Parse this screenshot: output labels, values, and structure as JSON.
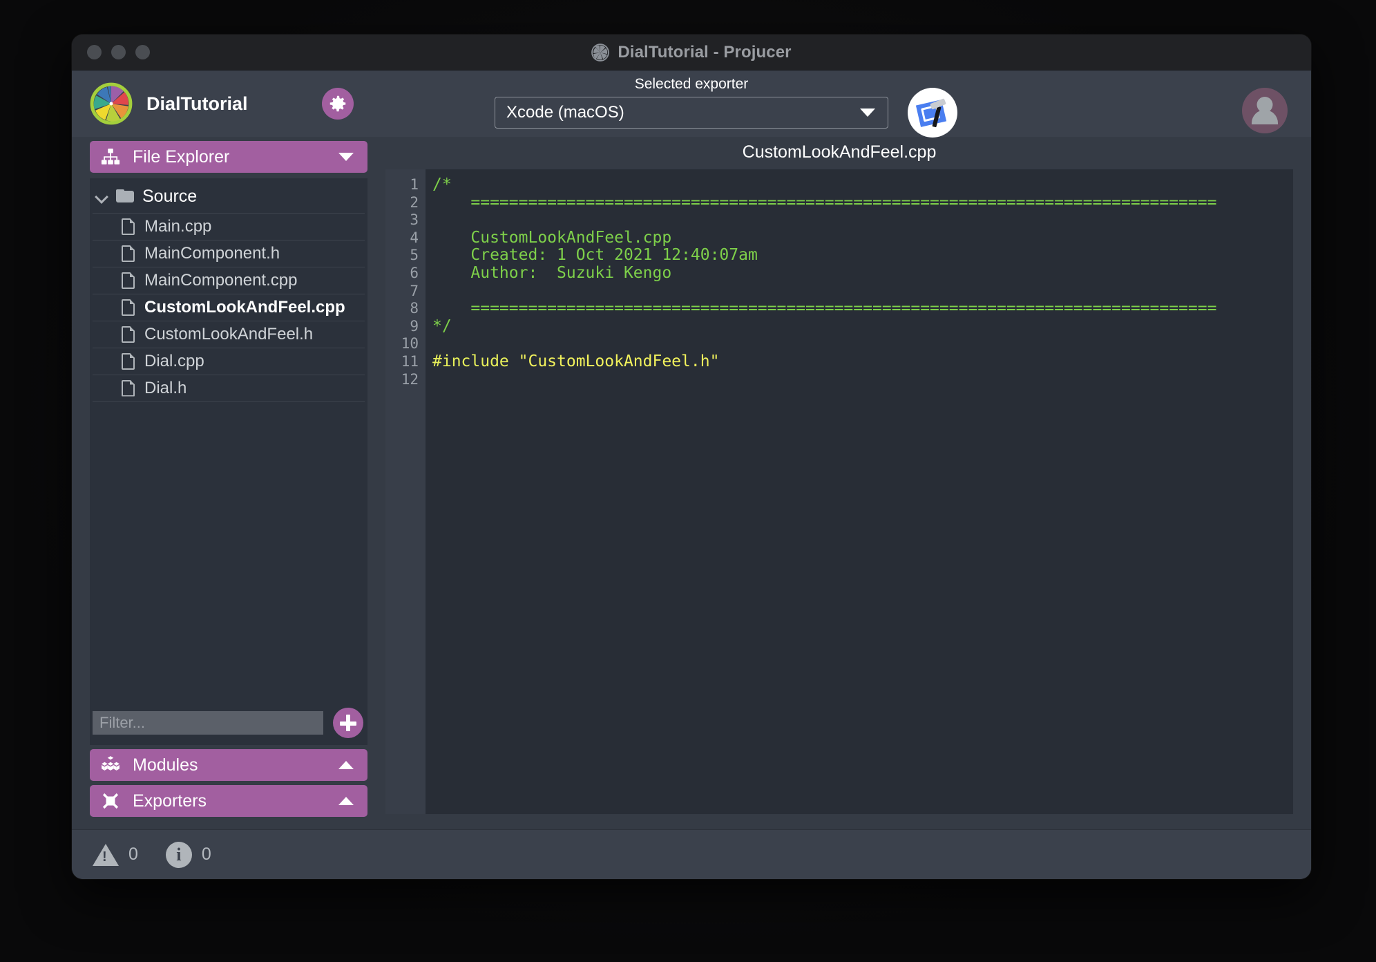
{
  "window": {
    "title": "DialTutorial - Projucer",
    "traffic_lights": [
      "close",
      "minimize",
      "maximize"
    ]
  },
  "toolbar": {
    "project_name": "DialTutorial",
    "settings_icon": "gear-icon",
    "exporter_label": "Selected exporter",
    "exporter_value": "Xcode (macOS)",
    "exporter_options": [
      "Xcode (macOS)"
    ],
    "launch_icon": "xcode-icon",
    "avatar_icon": "user-avatar-icon"
  },
  "sidebar": {
    "file_explorer": {
      "label": "File Explorer",
      "icon": "hierarchy-icon",
      "expanded": true,
      "arrow": "chevron-down-icon"
    },
    "group": {
      "label": "Source",
      "icon": "folder-icon",
      "chevron": "chevron-down-icon"
    },
    "files": [
      {
        "label": "Main.cpp",
        "selected": false
      },
      {
        "label": "MainComponent.h",
        "selected": false
      },
      {
        "label": "MainComponent.cpp",
        "selected": false
      },
      {
        "label": "CustomLookAndFeel.cpp",
        "selected": true
      },
      {
        "label": "CustomLookAndFeel.h",
        "selected": false
      },
      {
        "label": "Dial.cpp",
        "selected": false
      },
      {
        "label": "Dial.h",
        "selected": false
      }
    ],
    "filter_placeholder": "Filter...",
    "filter_value": "",
    "add_button_icon": "plus-icon",
    "modules": {
      "label": "Modules",
      "icon": "modules-cubes-icon",
      "arrow": "chevron-up-icon"
    },
    "exporters": {
      "label": "Exporters",
      "icon": "plug-icon",
      "arrow": "chevron-up-icon"
    }
  },
  "editor": {
    "filename": "CustomLookAndFeel.cpp",
    "line_numbers": [
      "1",
      "2",
      "3",
      "4",
      "5",
      "6",
      "7",
      "8",
      "9",
      "10",
      "11",
      "12"
    ],
    "lines": [
      {
        "n": 1,
        "segments": [
          {
            "text": "/*",
            "cls": "c-comment"
          }
        ]
      },
      {
        "n": 2,
        "segments": [
          {
            "text": "    ==============================================================================",
            "cls": "c-comment"
          }
        ]
      },
      {
        "n": 3,
        "segments": [
          {
            "text": "",
            "cls": "c-comment"
          }
        ]
      },
      {
        "n": 4,
        "segments": [
          {
            "text": "    CustomLookAndFeel.cpp",
            "cls": "c-comment"
          }
        ]
      },
      {
        "n": 5,
        "segments": [
          {
            "text": "    Created: 1 Oct 2021 12:40:07am",
            "cls": "c-comment"
          }
        ]
      },
      {
        "n": 6,
        "segments": [
          {
            "text": "    Author:  Suzuki Kengo",
            "cls": "c-comment"
          }
        ]
      },
      {
        "n": 7,
        "segments": [
          {
            "text": "",
            "cls": "c-comment"
          }
        ]
      },
      {
        "n": 8,
        "segments": [
          {
            "text": "    ==============================================================================",
            "cls": "c-comment"
          }
        ]
      },
      {
        "n": 9,
        "segments": [
          {
            "text": "*/",
            "cls": "c-comment"
          }
        ]
      },
      {
        "n": 10,
        "segments": [
          {
            "text": "",
            "cls": ""
          }
        ]
      },
      {
        "n": 11,
        "segments": [
          {
            "text": "#include ",
            "cls": "c-pre"
          },
          {
            "text": "\"CustomLookAndFeel.h\"",
            "cls": "c-str"
          }
        ]
      },
      {
        "n": 12,
        "segments": [
          {
            "text": "",
            "cls": ""
          }
        ]
      }
    ]
  },
  "statusbar": {
    "warnings_icon": "warning-triangle-icon",
    "warnings_count": "0",
    "info_icon": "info-circle-icon",
    "info_count": "0"
  },
  "colors": {
    "accent_purple": "#a25fa0",
    "toolbar_bg": "#3b414c",
    "panel_bg": "#2b313b",
    "editor_bg": "#282d36",
    "gutter_bg": "#383e49",
    "comment_green": "#7ed04a",
    "string_yellow": "#f2f25c",
    "titlebar_bg": "#212225"
  }
}
